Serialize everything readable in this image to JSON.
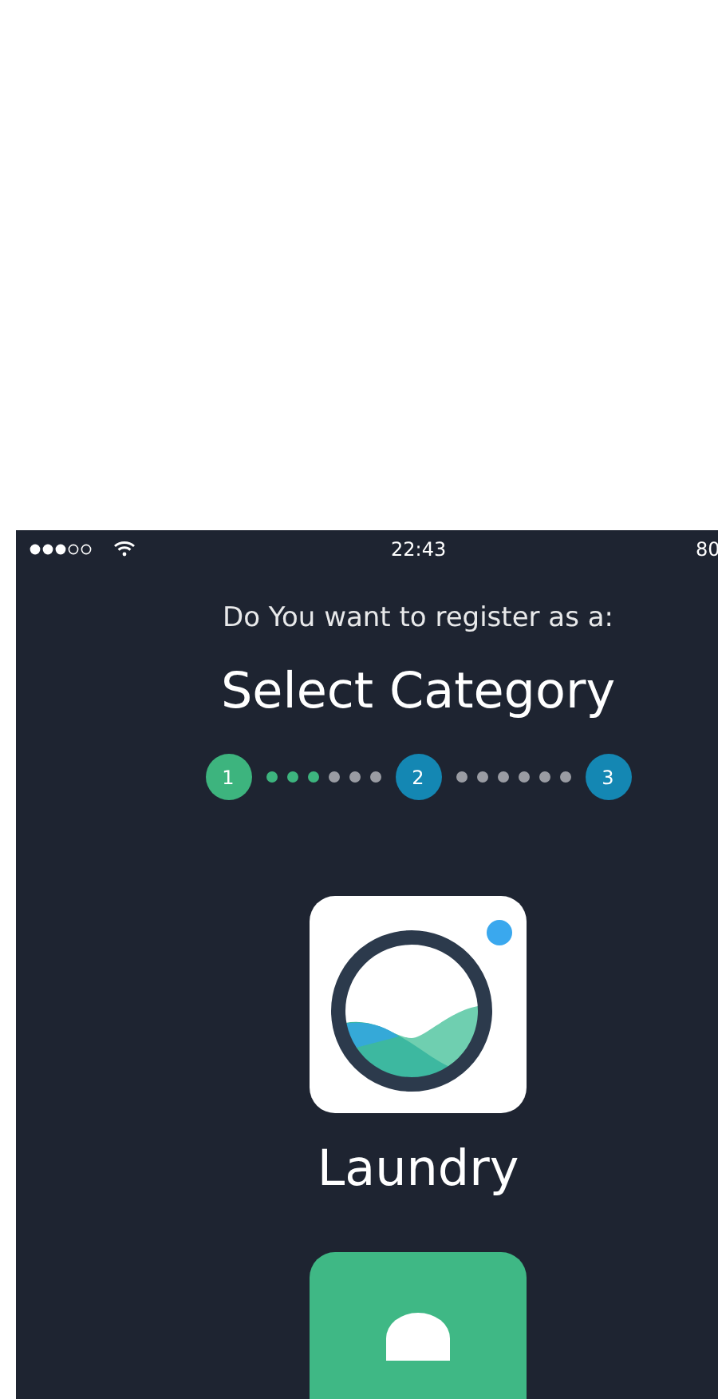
{
  "status_bar": {
    "time": "22:43",
    "battery": "80"
  },
  "subtitle": "Do You want to register as a:",
  "title": "Select Category",
  "stepper": [
    {
      "kind": "step",
      "label": "1",
      "done": true
    },
    {
      "kind": "dot",
      "done": true
    },
    {
      "kind": "dot",
      "done": true
    },
    {
      "kind": "dot",
      "done": true
    },
    {
      "kind": "dot",
      "done": false
    },
    {
      "kind": "dot",
      "done": false
    },
    {
      "kind": "dot",
      "done": false
    },
    {
      "kind": "step",
      "label": "2",
      "done": false
    },
    {
      "kind": "dot",
      "done": false
    },
    {
      "kind": "dot",
      "done": false
    },
    {
      "kind": "dot",
      "done": false
    },
    {
      "kind": "dot",
      "done": false
    },
    {
      "kind": "dot",
      "done": false
    },
    {
      "kind": "dot",
      "done": false
    },
    {
      "kind": "step",
      "label": "3",
      "done": false
    }
  ],
  "categories": [
    {
      "kind": "laundry",
      "label": "Laundry"
    },
    {
      "kind": "green"
    }
  ]
}
